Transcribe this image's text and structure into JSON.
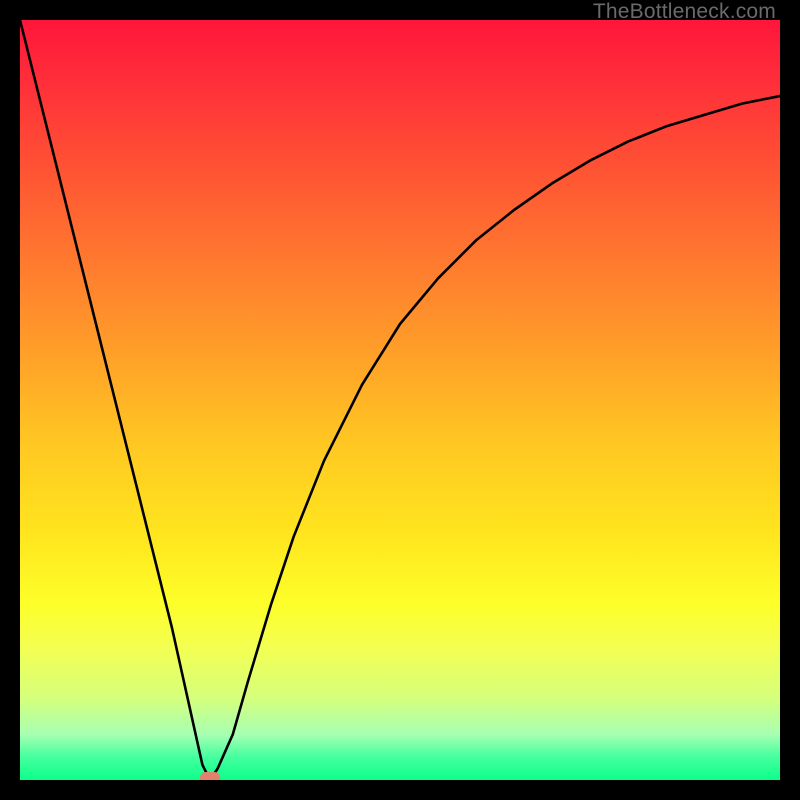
{
  "watermark": "TheBottleneck.com",
  "chart_data": {
    "type": "line",
    "title": "",
    "xlabel": "",
    "ylabel": "",
    "xlim": [
      0,
      100
    ],
    "ylim": [
      0,
      100
    ],
    "grid": false,
    "description": "Bottleneck curve: y falls linearly from top-left to zero near x≈25, then rises along a saturating curve toward ~90 at the right edge over a vertical rainbow gradient (red at top = high bottleneck, green at bottom = optimal).",
    "series": [
      {
        "name": "bottleneck-curve",
        "x": [
          0,
          5,
          10,
          15,
          20,
          24,
          25,
          26,
          28,
          30,
          33,
          36,
          40,
          45,
          50,
          55,
          60,
          65,
          70,
          75,
          80,
          85,
          90,
          95,
          100
        ],
        "values": [
          100,
          80,
          60,
          40,
          20,
          2,
          0,
          1.5,
          6,
          13,
          23,
          32,
          42,
          52,
          60,
          66,
          71,
          75,
          78.5,
          81.5,
          84,
          86,
          87.5,
          89,
          90
        ]
      }
    ],
    "marker": {
      "x": 25,
      "y": 0,
      "color": "#e2826d"
    },
    "gradient_stops": [
      {
        "pos": 0,
        "color": "#ff163a"
      },
      {
        "pos": 20,
        "color": "#ff5433"
      },
      {
        "pos": 44,
        "color": "#ffa028"
      },
      {
        "pos": 68,
        "color": "#ffe61e"
      },
      {
        "pos": 89,
        "color": "#d6ff7a"
      },
      {
        "pos": 100,
        "color": "#0cff8a"
      }
    ]
  }
}
